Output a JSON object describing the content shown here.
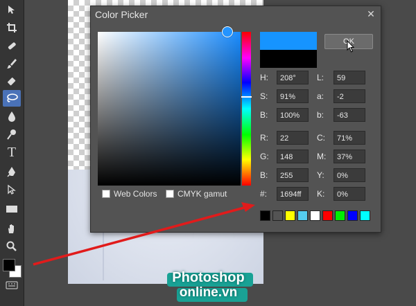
{
  "dialog": {
    "title": "Color Picker",
    "ok_label": "OK",
    "web_colors_label": "Web Colors",
    "cmyk_gamut_label": "CMYK gamut"
  },
  "colors": {
    "new": "#1694ff",
    "old": "#000000"
  },
  "picker": {
    "hue_deg": 208,
    "saturation_pct": 91,
    "brightness_pct": 100
  },
  "fields": [
    {
      "label": "H:",
      "value": "208°"
    },
    {
      "label": "S:",
      "value": "91%"
    },
    {
      "label": "B:",
      "value": "100%"
    },
    {
      "label": "R:",
      "value": "22"
    },
    {
      "label": "G:",
      "value": "148"
    },
    {
      "label": "B:",
      "value": "255"
    },
    {
      "label": "#:",
      "value": "1694ff"
    },
    {
      "label": "L:",
      "value": "59"
    },
    {
      "label": "a:",
      "value": "-2"
    },
    {
      "label": "b:",
      "value": "-63"
    },
    {
      "label": "C:",
      "value": "71%"
    },
    {
      "label": "M:",
      "value": "37%"
    },
    {
      "label": "Y:",
      "value": "0%"
    },
    {
      "label": "K:",
      "value": "0%"
    }
  ],
  "palette": [
    "#000000",
    "#545454",
    "#ffff00",
    "#55ccee",
    "#ffffff",
    "#ff0000",
    "#00ee00",
    "#0000ff",
    "#00ffff"
  ],
  "toolbar": {
    "tools": [
      "move-icon",
      "crop-icon",
      "healing-icon",
      "brush-icon",
      "eraser-icon",
      "lasso-icon",
      "blur-icon",
      "dodge-icon",
      "type-icon",
      "pen-icon",
      "path-select-icon",
      "shape-icon",
      "hand-icon",
      "zoom-icon"
    ],
    "foreground": "#000000",
    "background": "#ffffff"
  },
  "watermark": {
    "line1": "Photoshop",
    "line2": "online.vn"
  }
}
